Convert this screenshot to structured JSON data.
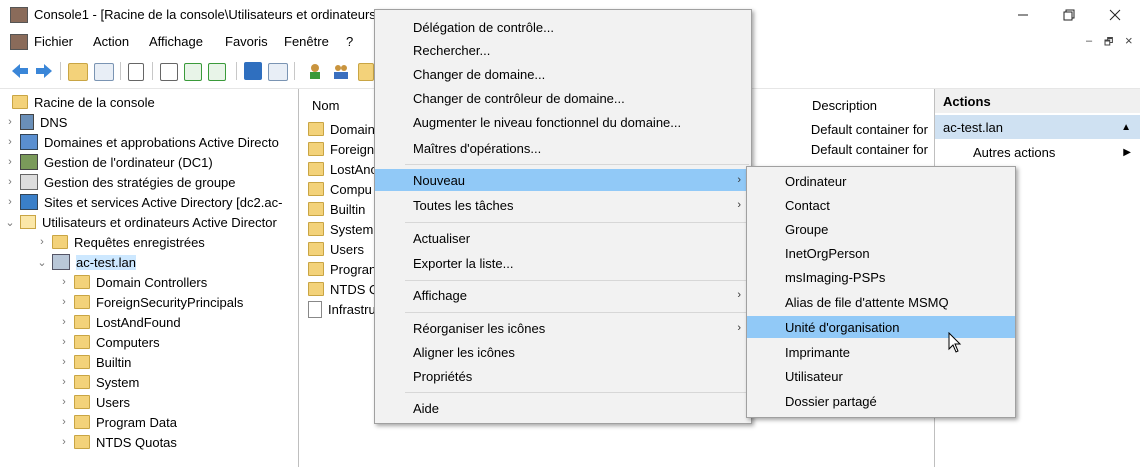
{
  "window": {
    "title": "Console1 - [Racine de la console\\Utilisateurs et ordinateurs",
    "controls": [
      "minimize-icon",
      "restore-icon",
      "close-icon"
    ]
  },
  "menubar": {
    "items": [
      "Fichier",
      "Action",
      "Affichage",
      "Favoris",
      "Fenêtre",
      "?"
    ],
    "mdi_controls": [
      "–",
      "🗗",
      "×"
    ]
  },
  "tree": {
    "items": [
      {
        "label": "Racine de la console"
      },
      {
        "label": "DNS"
      },
      {
        "label": "Domaines et approbations Active Directo"
      },
      {
        "label": "Gestion de l'ordinateur (DC1)"
      },
      {
        "label": "Gestion des stratégies de groupe"
      },
      {
        "label": "Sites et services Active Directory [dc2.ac-"
      },
      {
        "label": "Utilisateurs et ordinateurs Active Director"
      },
      {
        "label": "Requêtes enregistrées"
      },
      {
        "label": "ac-test.lan"
      },
      {
        "label": "Domain Controllers"
      },
      {
        "label": "ForeignSecurityPrincipals"
      },
      {
        "label": "LostAndFound"
      },
      {
        "label": "Computers"
      },
      {
        "label": "Builtin"
      },
      {
        "label": "System"
      },
      {
        "label": "Users"
      },
      {
        "label": "Program Data"
      },
      {
        "label": "NTDS Quotas"
      }
    ]
  },
  "center": {
    "columns": {
      "name": "Nom",
      "description": "Description"
    },
    "rows": [
      {
        "name": "Domain",
        "description": "Default container for"
      },
      {
        "name": "Foreign",
        "description": "Default container for"
      },
      {
        "name": "LostAnc",
        "description": ""
      },
      {
        "name": "Compu",
        "description": ""
      },
      {
        "name": "Builtin",
        "description": ""
      },
      {
        "name": "System",
        "description": ""
      },
      {
        "name": "Users",
        "description": ""
      },
      {
        "name": "Progran",
        "description": ""
      },
      {
        "name": "NTDS Q",
        "description": ""
      },
      {
        "name": "Infrastru",
        "description": ""
      }
    ]
  },
  "actions": {
    "header": "Actions",
    "selected": "ac-test.lan",
    "more": "Autres actions"
  },
  "context_menu": {
    "items": [
      "Délégation de contrôle...",
      "Rechercher...",
      "Changer de domaine...",
      "Changer de contrôleur de domaine...",
      "Augmenter le niveau fonctionnel du domaine...",
      "Maîtres d'opérations...",
      "Nouveau",
      "Toutes les tâches",
      "Actualiser",
      "Exporter la liste...",
      "Affichage",
      "Réorganiser les icônes",
      "Aligner les icônes",
      "Propriétés",
      "Aide"
    ],
    "highlighted": "Nouveau"
  },
  "submenu": {
    "items": [
      "Ordinateur",
      "Contact",
      "Groupe",
      "InetOrgPerson",
      "msImaging-PSPs",
      "Alias de file d'attente MSMQ",
      "Unité d'organisation",
      "Imprimante",
      "Utilisateur",
      "Dossier partagé"
    ],
    "highlighted": "Unité d'organisation"
  },
  "colors": {
    "menu_highlight": "#91c9f7",
    "selection": "#cde8ff",
    "folder": "#f3d27a"
  }
}
